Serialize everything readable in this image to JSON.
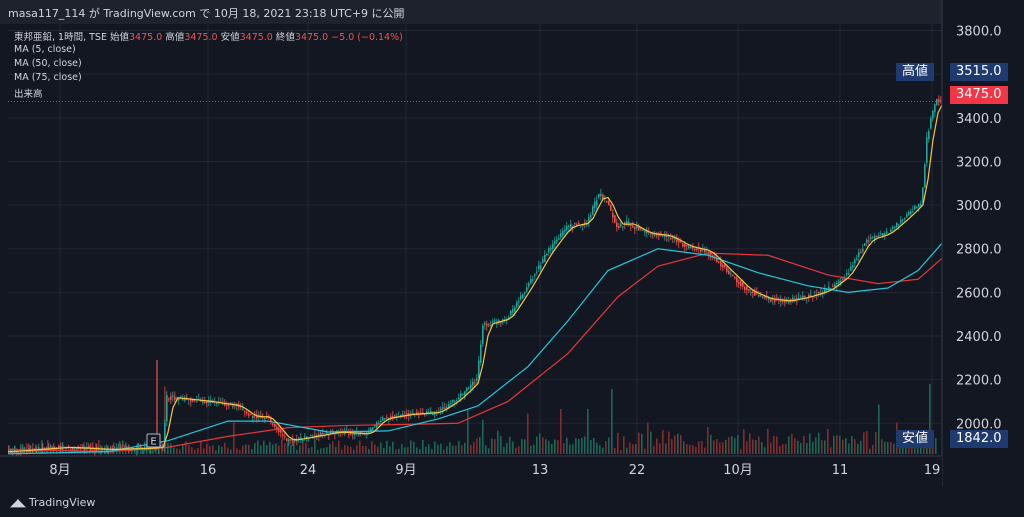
{
  "header": {
    "text": "masa117_114 が TradingView.com で 10月 18, 2021 23:18 UTC+9 に公開"
  },
  "legend": {
    "symbol_line": "東邦亜鉛, 1時間, TSE",
    "ohlc": [
      {
        "label": "始値",
        "value": "3475.0"
      },
      {
        "label": "高値",
        "value": "3475.0"
      },
      {
        "label": "安値",
        "value": "3475.0"
      },
      {
        "label": "終値",
        "value": "3475.0"
      }
    ],
    "change": "−5.0 (−0.14%)",
    "ma1": "MA (5, close)",
    "ma2": "MA (50, close)",
    "ma3": "MA (75, close)",
    "volume": "出来高"
  },
  "tags": {
    "high_label": "高値",
    "high_value": "3515.0",
    "last_value": "3475.0",
    "low_label": "安値",
    "low_value": "1842.0"
  },
  "event_marker": "E",
  "footer": {
    "logo_text": "TradingView"
  },
  "colors": {
    "background": "#131722",
    "up": "#26a69a",
    "down": "#ef5350",
    "ma5": "#f5c542",
    "ma50": "#26c6da",
    "ma75": "#e53935",
    "tag_blue": "#1e3a6e",
    "tag_red": "#f23645"
  },
  "chart_data": {
    "type": "candlestick",
    "title": "",
    "y_axis": {
      "ticks": [
        "3800.0",
        "3600.0",
        "3400.0",
        "3200.0",
        "3000.0",
        "2800.0",
        "2600.0",
        "2400.0",
        "2200.0",
        "2000.0"
      ],
      "range": [
        1850,
        3830
      ]
    },
    "x_axis": {
      "ticks": [
        "8月",
        "16",
        "24",
        "9月",
        "13",
        "22",
        "10月",
        "11",
        "19"
      ]
    },
    "grid": true,
    "high": 3515.0,
    "low": 1842.0,
    "last": 3475.0,
    "close_path": [
      [
        0,
        1870
      ],
      [
        60,
        1890
      ],
      [
        100,
        1880
      ],
      [
        140,
        1885
      ],
      [
        156,
        1890
      ],
      [
        160,
        2120
      ],
      [
        200,
        2100
      ],
      [
        230,
        2080
      ],
      [
        245,
        2030
      ],
      [
        260,
        2030
      ],
      [
        280,
        1920
      ],
      [
        300,
        1935
      ],
      [
        330,
        1960
      ],
      [
        360,
        1950
      ],
      [
        375,
        2020
      ],
      [
        400,
        2040
      ],
      [
        430,
        2050
      ],
      [
        450,
        2110
      ],
      [
        470,
        2200
      ],
      [
        476,
        2450
      ],
      [
        500,
        2480
      ],
      [
        520,
        2620
      ],
      [
        540,
        2780
      ],
      [
        560,
        2900
      ],
      [
        580,
        2920
      ],
      [
        592,
        3050
      ],
      [
        600,
        3020
      ],
      [
        610,
        2900
      ],
      [
        620,
        2920
      ],
      [
        640,
        2870
      ],
      [
        660,
        2860
      ],
      [
        680,
        2810
      ],
      [
        700,
        2790
      ],
      [
        720,
        2700
      ],
      [
        740,
        2610
      ],
      [
        760,
        2570
      ],
      [
        780,
        2560
      ],
      [
        800,
        2580
      ],
      [
        820,
        2610
      ],
      [
        840,
        2680
      ],
      [
        860,
        2840
      ],
      [
        880,
        2870
      ],
      [
        900,
        2950
      ],
      [
        915,
        3020
      ],
      [
        920,
        3300
      ],
      [
        925,
        3420
      ],
      [
        930,
        3480
      ],
      [
        935,
        3475
      ]
    ],
    "ma50_path": [
      [
        0,
        1860
      ],
      [
        100,
        1870
      ],
      [
        160,
        1920
      ],
      [
        220,
        2010
      ],
      [
        260,
        2010
      ],
      [
        320,
        1960
      ],
      [
        380,
        1965
      ],
      [
        430,
        2020
      ],
      [
        470,
        2080
      ],
      [
        520,
        2260
      ],
      [
        560,
        2470
      ],
      [
        600,
        2700
      ],
      [
        650,
        2800
      ],
      [
        700,
        2770
      ],
      [
        750,
        2690
      ],
      [
        800,
        2630
      ],
      [
        840,
        2600
      ],
      [
        880,
        2620
      ],
      [
        910,
        2700
      ],
      [
        935,
        2830
      ]
    ],
    "ma75_path": [
      [
        0,
        1880
      ],
      [
        100,
        1870
      ],
      [
        160,
        1890
      ],
      [
        220,
        1940
      ],
      [
        280,
        1980
      ],
      [
        340,
        1990
      ],
      [
        400,
        1995
      ],
      [
        450,
        2000
      ],
      [
        500,
        2100
      ],
      [
        560,
        2320
      ],
      [
        610,
        2580
      ],
      [
        650,
        2720
      ],
      [
        700,
        2780
      ],
      [
        760,
        2770
      ],
      [
        820,
        2680
      ],
      [
        870,
        2640
      ],
      [
        910,
        2660
      ],
      [
        935,
        2760
      ]
    ],
    "volume_spikes": [
      [
        156,
        0.75
      ],
      [
        225,
        0.35
      ],
      [
        460,
        0.5
      ],
      [
        475,
        0.38
      ],
      [
        520,
        0.45
      ],
      [
        552,
        0.5
      ],
      [
        578,
        0.5
      ],
      [
        603,
        0.72
      ],
      [
        640,
        0.35
      ],
      [
        700,
        0.3
      ],
      [
        760,
        0.28
      ],
      [
        820,
        0.28
      ],
      [
        870,
        0.55
      ],
      [
        888,
        0.35
      ],
      [
        920,
        0.78
      ],
      [
        930,
        0.45
      ]
    ]
  }
}
